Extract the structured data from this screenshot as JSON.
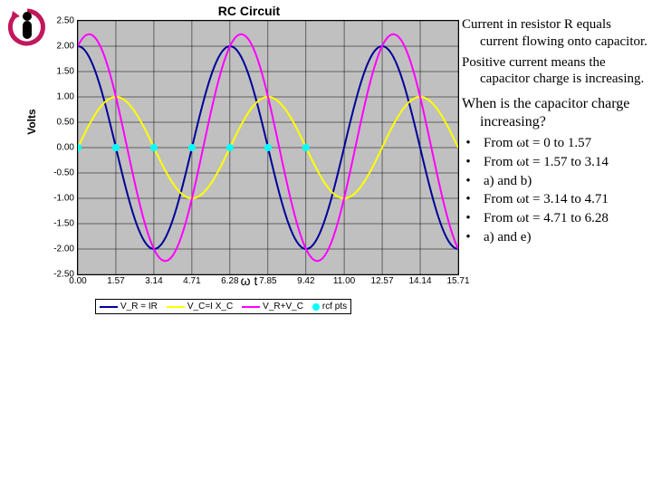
{
  "chart_data": {
    "type": "line",
    "title": "RC Circuit",
    "xlabel": "ω t",
    "ylabel": "Volts",
    "xlim": [
      0,
      15.71
    ],
    "ylim": [
      -2.5,
      2.5
    ],
    "x_ticks": [
      0.0,
      1.57,
      3.14,
      4.71,
      6.28,
      7.85,
      9.42,
      11.0,
      12.57,
      14.14,
      15.71
    ],
    "y_ticks": [
      2.5,
      2.0,
      1.5,
      1.0,
      0.5,
      0.0,
      -0.5,
      -1.0,
      -1.5,
      -2.0,
      -2.5
    ],
    "x_tick_labels": [
      "0.00",
      "1.57",
      "3.14",
      "4.71",
      "6.28",
      "7.85",
      "9.42",
      "11.00",
      "12.57",
      "14.14",
      "15.71"
    ],
    "y_tick_labels": [
      "2.50",
      "2.00",
      "1.50",
      "1.00",
      "0.50",
      "0.00",
      "-0.50",
      "-1.00",
      "-1.50",
      "-2.00",
      "-2.50"
    ],
    "series": [
      {
        "name": "V_R = IR",
        "color": "#000099",
        "amplitude": 2.0,
        "phase_deg": 0,
        "formula": "2*cos(x)"
      },
      {
        "name": "V_C=I X_C",
        "color": "#ffff00",
        "amplitude": 1.0,
        "phase_deg": -90,
        "formula": "1*sin(x)"
      },
      {
        "name": "V_R+V_C",
        "color": "#ff00ff",
        "amplitude": 2.236,
        "phase_deg": -26.57,
        "formula": "sqrt(5)*cos(x+atan(-0.5))"
      }
    ],
    "ref_points": {
      "name": "rcf pts",
      "color": "#00ffff",
      "x": [
        0.0,
        1.57,
        3.14,
        4.71,
        6.28,
        7.85,
        9.42
      ],
      "y": [
        0,
        0,
        0,
        0,
        0,
        0,
        0
      ]
    }
  },
  "legend": {
    "items": [
      "V_R = IR",
      "V_C=I X_C",
      "V_R+V_C",
      "rcf pts"
    ]
  },
  "text_panel": {
    "para1": "Current in resistor R equals current flowing onto capacitor.",
    "para2": "Positive current means the capacitor charge is increasing.",
    "question": "When is the capacitor charge increasing?",
    "options": [
      "From ωt = 0 to 1.57",
      "From ωt = 1.57 to 3.14",
      " a) and b)",
      "From ωt = 3.14 to 4.71",
      "From ωt = 4.71 to 6.28",
      " a) and e)"
    ]
  }
}
